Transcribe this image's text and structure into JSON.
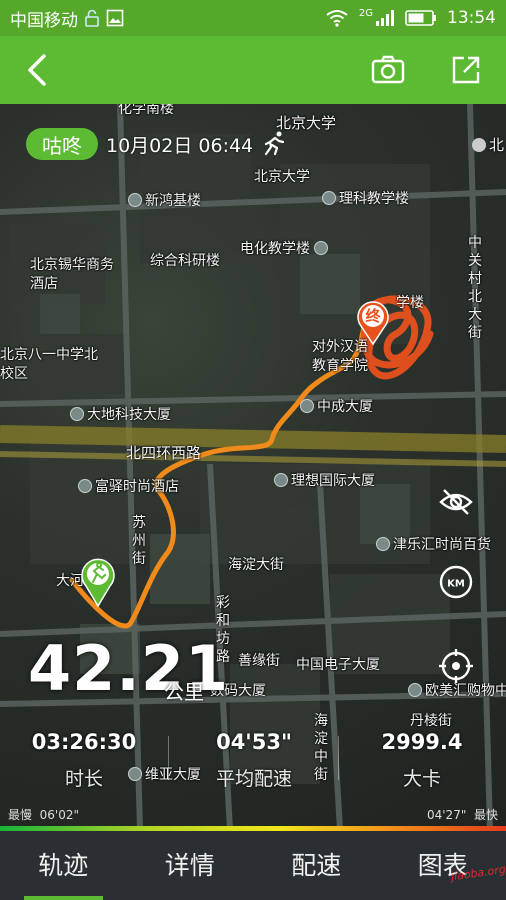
{
  "status_bar": {
    "carrier": "中国移动",
    "network": "2G",
    "time": "13:54"
  },
  "app_bar": {
    "back_icon": "back-arrow-icon",
    "camera_icon": "camera-icon",
    "share_icon": "share-icon"
  },
  "map": {
    "brand": "咕咚",
    "datetime": "10月02日 06:44",
    "end_marker": "终",
    "labels": [
      "北京大学",
      "北京大学",
      "新鸿基楼",
      "理科教学楼",
      "电化教学楼",
      "综合科研楼",
      "北京锡华商务酒店",
      "北京八一中学北校区",
      "对外汉语教育学院",
      "中成大厦",
      "大地科技大厦",
      "北四环西路",
      "富驿时尚酒店",
      "理想国际大厦",
      "苏州街",
      "海淀大街",
      "津乐汇时尚百货",
      "彩和坊路",
      "善缘街",
      "中国电子大厦",
      "数码大厦",
      "欧美汇购物中",
      "丹棱街",
      "海淀中街",
      "维亚大厦",
      "中关村北大街",
      "化学南楼",
      "学楼",
      "北",
      "大河庄苑"
    ]
  },
  "stats": {
    "distance": "42.21",
    "distance_unit": "公里",
    "duration": {
      "value": "03:26:30",
      "label": "时长"
    },
    "pace": {
      "value": "04'53\"",
      "label": "平均配速"
    },
    "calories": {
      "value": "2999.4",
      "label": "大卡"
    }
  },
  "pace_bar": {
    "slowest_label": "最慢",
    "slowest_value": "06'02\"",
    "fastest_value": "04'27\"",
    "fastest_label": "最快"
  },
  "tabs": [
    {
      "label": "轨迹",
      "active": true
    },
    {
      "label": "详情",
      "active": false
    },
    {
      "label": "配速",
      "active": false
    },
    {
      "label": "图表",
      "active": false
    }
  ],
  "watermark": "jiaoba.org"
}
